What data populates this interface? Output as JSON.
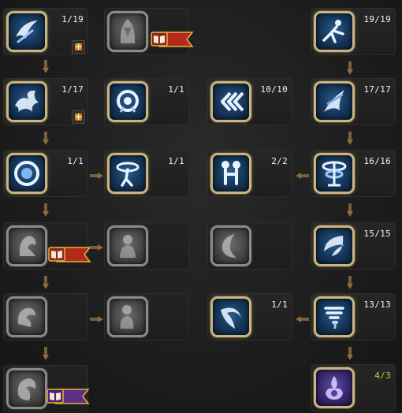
{
  "colors": {
    "active_frame": "#c9b483",
    "locked_frame": "#8a8a8a",
    "arrow": "#8c6c42",
    "over_level": "#b6d84a",
    "plus_button": "#e07a18",
    "flag_red": "#b32a1c",
    "flag_purple": "#5b2f86"
  },
  "skills": [
    {
      "name": "skill-1",
      "state": "active",
      "icon": "wind-slash-icon",
      "level": "1/19",
      "plus": true
    },
    {
      "name": "skill-2",
      "state": "locked",
      "icon": "cloak-figure-icon",
      "level": "",
      "plus": false,
      "flag": "red"
    },
    {
      "name": "skill-3",
      "state": "active",
      "icon": "leaping-figure-icon",
      "level": "19/19",
      "plus": false
    },
    {
      "name": "skill-4",
      "state": "active",
      "icon": "storm-burst-icon",
      "level": "1/17",
      "plus": true
    },
    {
      "name": "skill-5",
      "state": "active",
      "icon": "target-ring-icon",
      "level": "1/1",
      "plus": false
    },
    {
      "name": "skill-6",
      "state": "active",
      "icon": "triple-chevron-icon",
      "level": "10/10",
      "plus": false
    },
    {
      "name": "skill-7",
      "state": "active",
      "icon": "blade-swirl-icon",
      "level": "17/17",
      "plus": false
    },
    {
      "name": "skill-8",
      "state": "active",
      "icon": "orb-icon",
      "level": "1/1",
      "plus": false
    },
    {
      "name": "skill-9",
      "state": "active",
      "icon": "vortex-figure-icon",
      "level": "1/1",
      "plus": false
    },
    {
      "name": "skill-10",
      "state": "active",
      "icon": "twin-figures-icon",
      "level": "2/2",
      "plus": false
    },
    {
      "name": "skill-11",
      "state": "active",
      "icon": "whirlwind-icon",
      "level": "16/16",
      "plus": false
    },
    {
      "name": "skill-12",
      "state": "locked",
      "icon": "hooded-figure-icon",
      "level": "",
      "plus": false,
      "flag": "red"
    },
    {
      "name": "skill-13",
      "state": "locked",
      "icon": "spirit-icon",
      "level": "",
      "plus": false
    },
    {
      "name": "skill-14",
      "state": "locked",
      "icon": "crescent-icon",
      "level": "",
      "plus": false
    },
    {
      "name": "skill-15",
      "state": "active",
      "icon": "crescent-slash-icon",
      "level": "15/15",
      "plus": false
    },
    {
      "name": "skill-16",
      "state": "locked",
      "icon": "beast-icon",
      "level": "",
      "plus": false
    },
    {
      "name": "skill-17",
      "state": "locked",
      "icon": "spirit-summon-icon",
      "level": "",
      "plus": false
    },
    {
      "name": "skill-18",
      "state": "active",
      "icon": "sweeping-arc-icon",
      "level": "1/1",
      "plus": false
    },
    {
      "name": "skill-19",
      "state": "active",
      "icon": "cyclone-icon",
      "level": "13/13",
      "plus": false
    },
    {
      "name": "skill-20",
      "state": "locked",
      "icon": "swirl-hand-icon",
      "level": "",
      "plus": false,
      "flag": "purple"
    },
    {
      "name": "skill-21",
      "state": "passive",
      "icon": "purple-flame-icon",
      "level": "4/3",
      "plus": false
    }
  ]
}
